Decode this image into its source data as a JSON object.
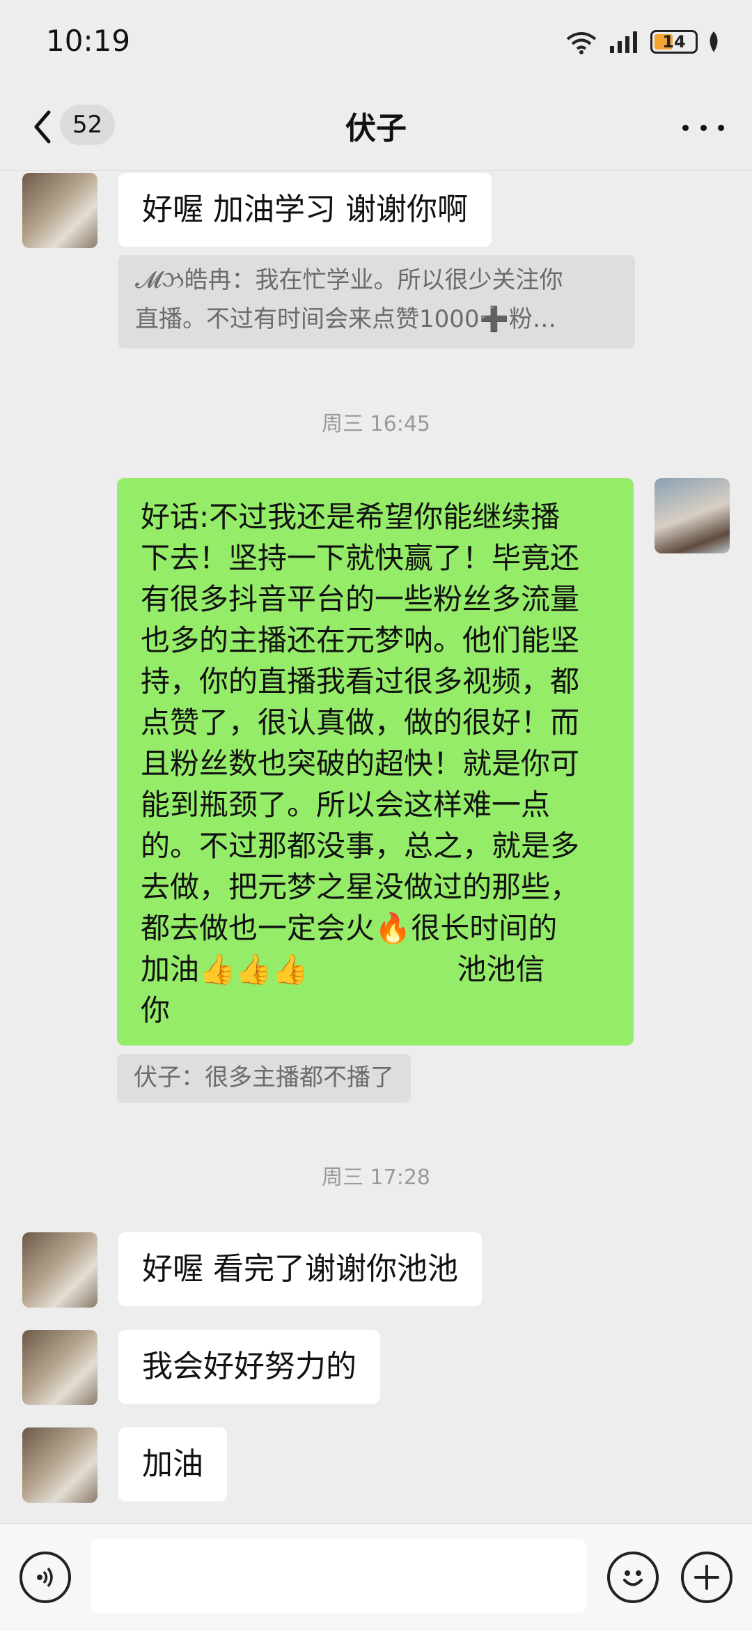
{
  "status": {
    "time": "10:19",
    "battery": "14"
  },
  "header": {
    "unread_count": "52",
    "title": "伏子"
  },
  "messages": {
    "m1": "好喔 加油学习 谢谢你啊",
    "q1_line1": "𝓜ઝ皓冉：我在忙学业。所以很少关注你",
    "q1_line2": "直播。不过有时间会来点赞1000➕粉…",
    "ts1": "周三 16:45",
    "m2_lines": [
      "好话:不过我还是希望你能继续播",
      "下去！坚持一下就快赢了！毕竟还",
      "有很多抖音平台的一些粉丝多流量",
      "也多的主播还在元梦呐。他们能坚",
      "持，你的直播我看过很多视频，都",
      "点赞了，很认真做，做的很好！而",
      "且粉丝数也突破的超快！就是你可",
      "能到瓶颈了。所以会这样难一点",
      "的。不过那都没事，总之，就是多",
      "去做，把元梦之星没做过的那些，",
      "都去做也一定会火🔥很长时间的",
      "加油👍👍👍                池池信",
      "你"
    ],
    "q2": "伏子：很多主播都不播了",
    "ts2": "周三 17:28",
    "m3": "好喔 看完了谢谢你池池",
    "m4": "我会好好努力的",
    "m5": "加油"
  },
  "icons": {
    "back": "chevron-left-icon",
    "more": "more-icon",
    "voice": "voice-icon",
    "emoji": "emoji-icon",
    "plus": "plus-icon"
  }
}
